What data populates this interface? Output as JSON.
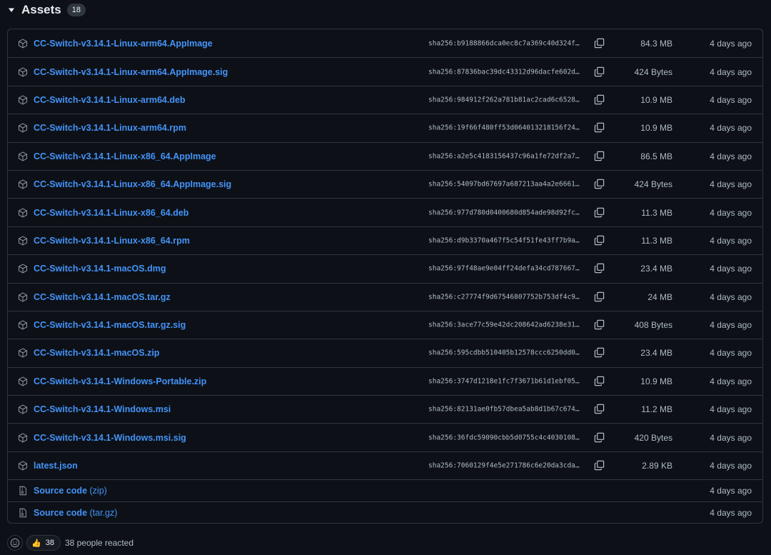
{
  "header": {
    "title": "Assets",
    "count": "18"
  },
  "assets": [
    {
      "name": "CC-Switch-v3.14.1-Linux-arm64.AppImage",
      "sha": "sha256:b9188866dca0ec8c7a369c40d324f…",
      "size": "84.3 MB",
      "date": "4 days ago"
    },
    {
      "name": "CC-Switch-v3.14.1-Linux-arm64.AppImage.sig",
      "sha": "sha256:87836bac39dc43312d96dacfe602d…",
      "size": "424 Bytes",
      "date": "4 days ago"
    },
    {
      "name": "CC-Switch-v3.14.1-Linux-arm64.deb",
      "sha": "sha256:984912f262a781b81ac2cad6c6528…",
      "size": "10.9 MB",
      "date": "4 days ago"
    },
    {
      "name": "CC-Switch-v3.14.1-Linux-arm64.rpm",
      "sha": "sha256:19f66f480ff53d064013218156f24…",
      "size": "10.9 MB",
      "date": "4 days ago"
    },
    {
      "name": "CC-Switch-v3.14.1-Linux-x86_64.AppImage",
      "sha": "sha256:a2e5c4183156437c96a1fe72df2a7…",
      "size": "86.5 MB",
      "date": "4 days ago"
    },
    {
      "name": "CC-Switch-v3.14.1-Linux-x86_64.AppImage.sig",
      "sha": "sha256:54097bd67697a687213aa4a2e6661…",
      "size": "424 Bytes",
      "date": "4 days ago"
    },
    {
      "name": "CC-Switch-v3.14.1-Linux-x86_64.deb",
      "sha": "sha256:977d780d0400680d854ade98d92fc…",
      "size": "11.3 MB",
      "date": "4 days ago"
    },
    {
      "name": "CC-Switch-v3.14.1-Linux-x86_64.rpm",
      "sha": "sha256:d9b3370a467f5c54f51fe43ff7b9a…",
      "size": "11.3 MB",
      "date": "4 days ago"
    },
    {
      "name": "CC-Switch-v3.14.1-macOS.dmg",
      "sha": "sha256:97f48ae9e04ff24defa34cd787667…",
      "size": "23.4 MB",
      "date": "4 days ago"
    },
    {
      "name": "CC-Switch-v3.14.1-macOS.tar.gz",
      "sha": "sha256:c27774f9d67546807752b753df4c9…",
      "size": "24 MB",
      "date": "4 days ago"
    },
    {
      "name": "CC-Switch-v3.14.1-macOS.tar.gz.sig",
      "sha": "sha256:3ace77c59e42dc208642ad6238e31…",
      "size": "408 Bytes",
      "date": "4 days ago"
    },
    {
      "name": "CC-Switch-v3.14.1-macOS.zip",
      "sha": "sha256:595cdbb510405b12578ccc6250dd0…",
      "size": "23.4 MB",
      "date": "4 days ago"
    },
    {
      "name": "CC-Switch-v3.14.1-Windows-Portable.zip",
      "sha": "sha256:3747d1218e1fc7f3671b61d1ebf05…",
      "size": "10.9 MB",
      "date": "4 days ago"
    },
    {
      "name": "CC-Switch-v3.14.1-Windows.msi",
      "sha": "sha256:82131ae0fb57dbea5ab8d1b67c674…",
      "size": "11.2 MB",
      "date": "4 days ago"
    },
    {
      "name": "CC-Switch-v3.14.1-Windows.msi.sig",
      "sha": "sha256:36fdc59090cbb5d0755c4c4030108…",
      "size": "420 Bytes",
      "date": "4 days ago"
    },
    {
      "name": "latest.json",
      "sha": "sha256:7060129f4e5e271786c6e20da3cda…",
      "size": "2.89 KB",
      "date": "4 days ago"
    }
  ],
  "sources": [
    {
      "label": "Source code",
      "suffix": "(zip)",
      "date": "4 days ago"
    },
    {
      "label": "Source code",
      "suffix": "(tar.gz)",
      "date": "4 days ago"
    }
  ],
  "reactions": {
    "emoji": "👍",
    "count": "38",
    "text": "38 people reacted"
  },
  "icons": {
    "asset": "package-icon",
    "source": "file-zip-icon",
    "copy": "copy-icon",
    "caret": "triangle-down-icon",
    "add_reaction": "smiley-icon"
  },
  "colors": {
    "link": "#4493f8",
    "muted": "#b1bac4",
    "border": "#30363d",
    "background": "#0d1117"
  }
}
